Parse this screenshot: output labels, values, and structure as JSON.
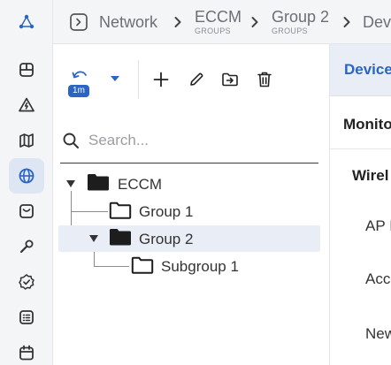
{
  "rail": {
    "items": [
      {
        "icon": "dashboard-icon"
      },
      {
        "icon": "alerts-icon"
      },
      {
        "icon": "map-icon"
      },
      {
        "icon": "network-globe-icon",
        "active": true
      },
      {
        "icon": "inbox-icon"
      },
      {
        "icon": "tools-icon"
      },
      {
        "icon": "compliance-icon"
      },
      {
        "icon": "list-icon"
      },
      {
        "icon": "calendar-icon"
      }
    ]
  },
  "breadcrumb": {
    "items": [
      {
        "label": "Network",
        "sub": ""
      },
      {
        "label": "ECCM",
        "sub": "GROUPS"
      },
      {
        "label": "Group 2",
        "sub": "GROUPS"
      },
      {
        "label": "Dev",
        "sub": ""
      }
    ]
  },
  "toolbar": {
    "refresh_interval": "1m"
  },
  "search": {
    "placeholder": "Search..."
  },
  "tree": {
    "nodes": [
      {
        "label": "ECCM",
        "expanded": true
      },
      {
        "label": "Group 1"
      },
      {
        "label": "Group 2",
        "expanded": true,
        "selected": true
      },
      {
        "label": "Subgroup 1"
      }
    ]
  },
  "details": {
    "tab_label": "Device",
    "card_title": "Monito",
    "section_label": "Wirel",
    "items": [
      "AP I",
      "Acc",
      "New"
    ]
  },
  "colors": {
    "accent": "#2a64c4",
    "rail_background": "#f4f5f7",
    "selected_row": "#e8edf6"
  }
}
